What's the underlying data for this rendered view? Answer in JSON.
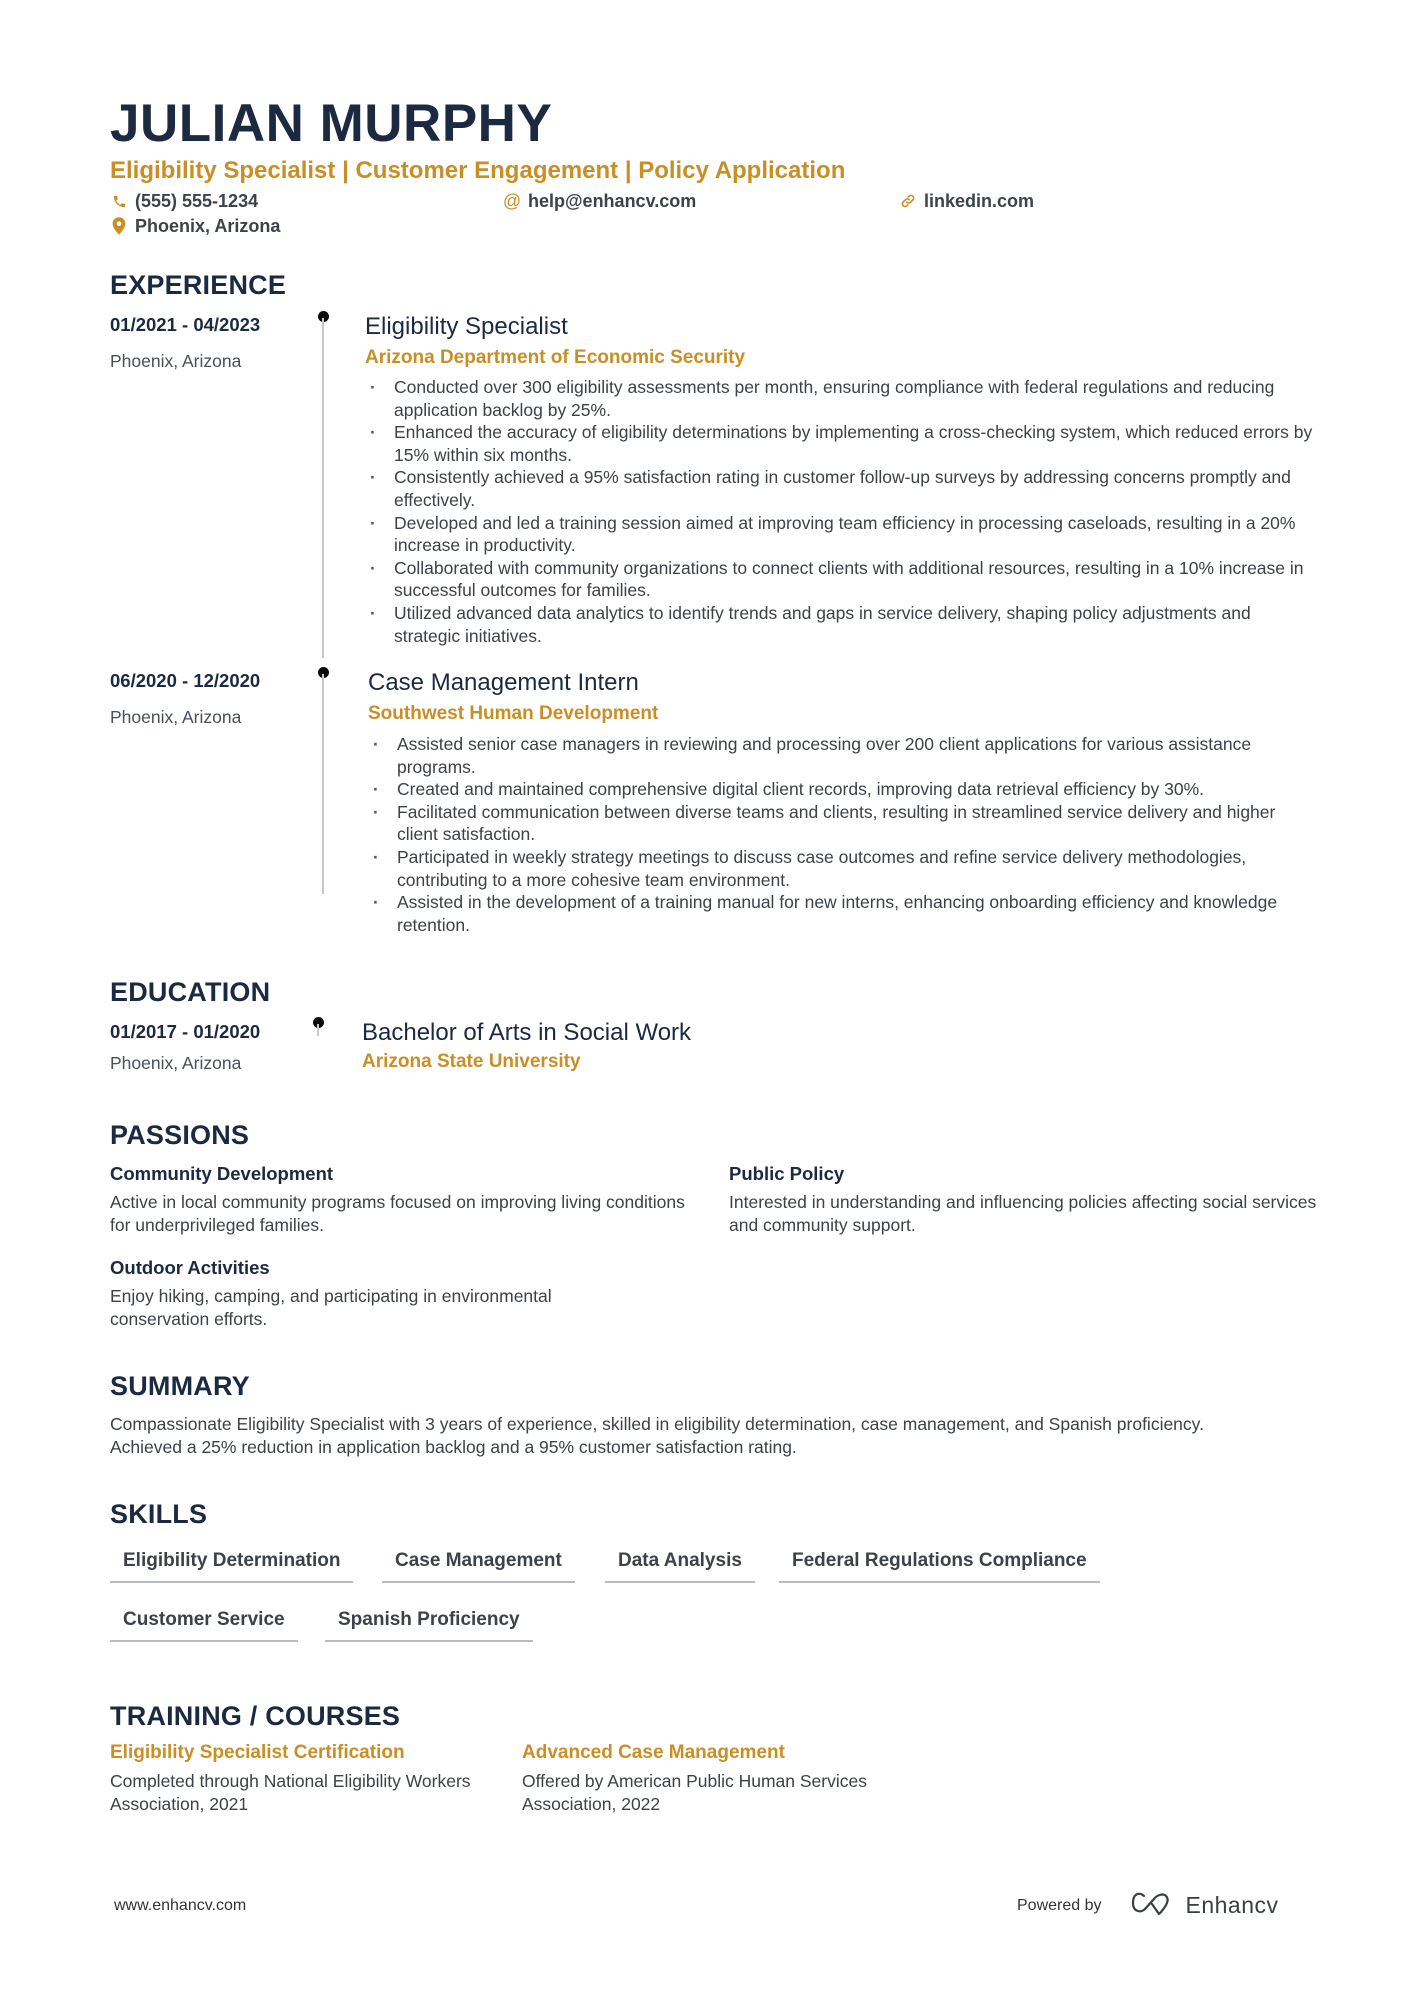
{
  "header": {
    "name": "JULIAN MURPHY",
    "subtitle": "Eligibility Specialist | Customer Engagement | Policy Application",
    "contacts": {
      "phone": {
        "icon": "phone-icon",
        "text": "(555) 555-1234"
      },
      "email": {
        "icon": "at-icon",
        "text": "help@enhancv.com"
      },
      "linkedin": {
        "icon": "link-icon",
        "text": "linkedin.com"
      },
      "location": {
        "icon": "map-pin-icon",
        "text": "Phoenix, Arizona"
      }
    }
  },
  "colors": {
    "accent": "#c98e24",
    "heading": "#1b2a41",
    "body": "#3c4248"
  },
  "experience": {
    "title": "EXPERIENCE",
    "items": [
      {
        "dates": "01/2021 - 04/2023",
        "location": "Phoenix, Arizona",
        "role": "Eligibility Specialist",
        "company": "Arizona Department of Economic Security",
        "bullets": [
          "Conducted over 300 eligibility assessments per month, ensuring compliance with federal regulations and reducing application backlog by 25%.",
          "Enhanced the accuracy of eligibility determinations by implementing a cross-checking system, which reduced errors by 15% within six months.",
          "Consistently achieved a 95% satisfaction rating in customer follow-up surveys by addressing concerns promptly and effectively.",
          "Developed and led a training session aimed at improving team efficiency in processing caseloads, resulting in a 20% increase in productivity.",
          "Collaborated with community organizations to connect clients with additional resources, resulting in a 10% increase in successful outcomes for families.",
          "Utilized advanced data analytics to identify trends and gaps in service delivery, shaping policy adjustments and strategic initiatives."
        ]
      },
      {
        "dates": "06/2020 - 12/2020",
        "location": "Phoenix, Arizona",
        "role": "Case Management Intern",
        "company": "Southwest Human Development",
        "bullets": [
          "Assisted senior case managers in reviewing and processing over 200 client applications for various assistance programs.",
          "Created and maintained comprehensive digital client records, improving data retrieval efficiency by 30%.",
          "Facilitated communication between diverse teams and clients, resulting in streamlined service delivery and higher client satisfaction.",
          "Participated in weekly strategy meetings to discuss case outcomes and refine service delivery methodologies, contributing to a more cohesive team environment.",
          "Assisted in the development of a training manual for new interns, enhancing onboarding efficiency and knowledge retention."
        ]
      }
    ]
  },
  "education": {
    "title": "EDUCATION",
    "items": [
      {
        "dates": "01/2017 - 01/2020",
        "location": "Phoenix, Arizona",
        "degree": "Bachelor of Arts in Social Work",
        "school": "Arizona State University"
      }
    ]
  },
  "passions": {
    "title": "PASSIONS",
    "items": [
      {
        "title": "Community Development",
        "description": "Active in local community programs focused on improving living conditions for underprivileged families."
      },
      {
        "title": "Public Policy",
        "description": "Interested in understanding and influencing policies affecting social services and community support."
      },
      {
        "title": "Outdoor Activities",
        "description": "Enjoy hiking, camping, and participating in environmental conservation efforts."
      }
    ]
  },
  "summary": {
    "title": "SUMMARY",
    "text": "Compassionate Eligibility Specialist with 3 years of experience, skilled in eligibility determination, case management, and Spanish proficiency. Achieved a 25% reduction in application backlog and a 95% customer satisfaction rating."
  },
  "skills": {
    "title": "SKILLS",
    "items": [
      "Eligibility Determination",
      "Case Management",
      "Data Analysis",
      "Federal Regulations Compliance",
      "Customer Service",
      "Spanish Proficiency"
    ]
  },
  "training": {
    "title": "TRAINING / COURSES",
    "items": [
      {
        "title": "Eligibility Specialist Certification",
        "description": "Completed through National Eligibility Workers Association, 2021"
      },
      {
        "title": "Advanced Case Management",
        "description": "Offered by American Public Human Services Association, 2022"
      }
    ]
  },
  "footer": {
    "website": "www.enhancv.com",
    "powered_by": "Powered by",
    "brand": "Enhancv",
    "brand_icon": "enhancv-logo-icon"
  }
}
